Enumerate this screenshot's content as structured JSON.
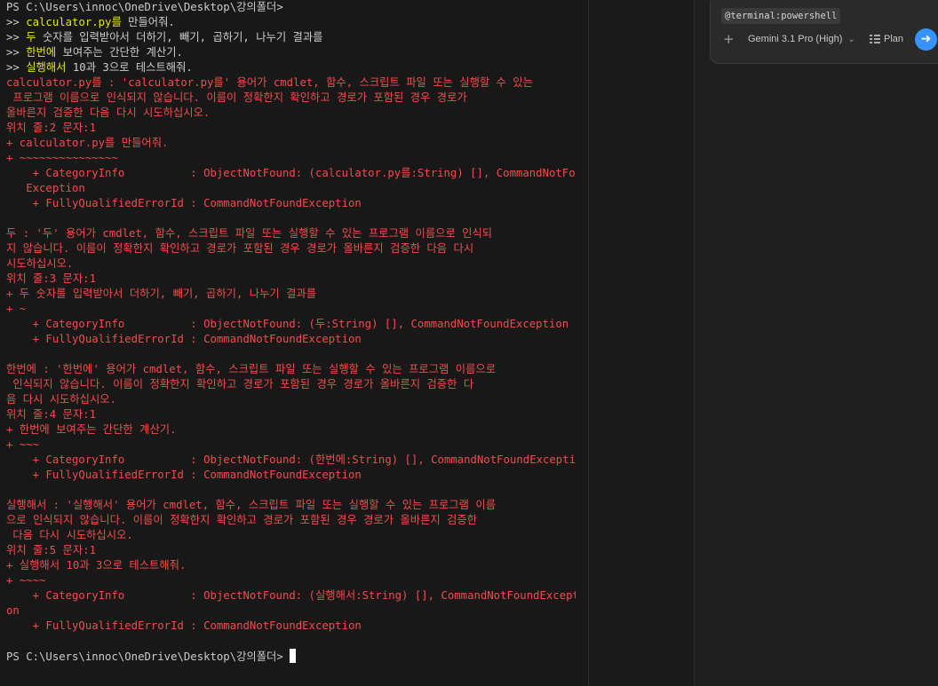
{
  "terminal": {
    "lines": [
      {
        "parts": [
          {
            "t": "PS C:\\Users\\innoc\\OneDrive\\Desktop\\강의폴더> ",
            "c": "prompt"
          }
        ]
      },
      {
        "parts": [
          {
            "t": ">> ",
            "c": "prompt"
          },
          {
            "t": "calculator.py를",
            "c": "cmd"
          },
          {
            "t": " 만들어줘.",
            "c": "arg"
          }
        ]
      },
      {
        "parts": [
          {
            "t": ">> ",
            "c": "prompt"
          },
          {
            "t": "두",
            "c": "cmd"
          },
          {
            "t": " 숫자를 입력받아서 더하기, 빼기, 곱하기, 나누기 결과를",
            "c": "arg"
          }
        ]
      },
      {
        "parts": [
          {
            "t": ">> ",
            "c": "prompt"
          },
          {
            "t": "한번에",
            "c": "cmd"
          },
          {
            "t": " 보여주는 간단한 계산기.",
            "c": "arg"
          }
        ]
      },
      {
        "parts": [
          {
            "t": ">> ",
            "c": "prompt"
          },
          {
            "t": "실행해서",
            "c": "cmd"
          },
          {
            "t": " 10과 3으로 테스트해줘.",
            "c": "arg"
          }
        ]
      },
      {
        "parts": [
          {
            "t": "calculator.py를 : 'calculator.py를' 용어가 cmdlet, 함수, 스크립트 파일 또는 실행할 수 있는",
            "c": "err"
          }
        ]
      },
      {
        "parts": [
          {
            "t": " 프로그램 이름으로 인식되지 않습니다. 이름이 정확한지 확인하고 경로가 포함된 경우 경로가",
            "c": "err"
          }
        ]
      },
      {
        "parts": [
          {
            "t": "올바른지 검증한 다음 다시 시도하십시오.",
            "c": "err"
          }
        ]
      },
      {
        "parts": [
          {
            "t": "위치 줄:2 문자:1",
            "c": "err"
          }
        ]
      },
      {
        "parts": [
          {
            "t": "+ calculator.py를 만들어줘.",
            "c": "err"
          }
        ]
      },
      {
        "parts": [
          {
            "t": "+ ~~~~~~~~~~~~~~~",
            "c": "err"
          }
        ]
      },
      {
        "parts": [
          {
            "t": "    + CategoryInfo          : ObjectNotFound: (calculator.py를:String) [], CommandNotFound",
            "c": "err"
          }
        ]
      },
      {
        "parts": [
          {
            "t": "   Exception",
            "c": "err"
          }
        ]
      },
      {
        "parts": [
          {
            "t": "    + FullyQualifiedErrorId : CommandNotFoundException",
            "c": "err"
          }
        ]
      },
      {
        "parts": [
          {
            "t": " ",
            "c": "err"
          }
        ]
      },
      {
        "parts": [
          {
            "t": "두 : '두' 용어가 cmdlet, 함수, 스크립트 파일 또는 실행할 수 있는 프로그램 이름으로 인식되",
            "c": "err"
          }
        ]
      },
      {
        "parts": [
          {
            "t": "지 않습니다. 이름이 정확한지 확인하고 경로가 포함된 경우 경로가 올바른지 검증한 다음 다시",
            "c": "err"
          }
        ]
      },
      {
        "parts": [
          {
            "t": "시도하십시오.",
            "c": "err"
          }
        ]
      },
      {
        "parts": [
          {
            "t": "위치 줄:3 문자:1",
            "c": "err"
          }
        ]
      },
      {
        "parts": [
          {
            "t": "+ 두 숫자를 입력받아서 더하기, 빼기, 곱하기, 나누기 결과를",
            "c": "err"
          }
        ]
      },
      {
        "parts": [
          {
            "t": "+ ~",
            "c": "err"
          }
        ]
      },
      {
        "parts": [
          {
            "t": "    + CategoryInfo          : ObjectNotFound: (두:String) [], CommandNotFoundException",
            "c": "err"
          }
        ]
      },
      {
        "parts": [
          {
            "t": "    + FullyQualifiedErrorId : CommandNotFoundException",
            "c": "err"
          }
        ]
      },
      {
        "parts": [
          {
            "t": " ",
            "c": "err"
          }
        ]
      },
      {
        "parts": [
          {
            "t": "한번에 : '한번에' 용어가 cmdlet, 함수, 스크립트 파일 또는 실행할 수 있는 프로그램 이름으로",
            "c": "err"
          }
        ]
      },
      {
        "parts": [
          {
            "t": " 인식되지 않습니다. 이름이 정확한지 확인하고 경로가 포함된 경우 경로가 올바른지 검증한 다",
            "c": "err"
          }
        ]
      },
      {
        "parts": [
          {
            "t": "음 다시 시도하십시오.",
            "c": "err"
          }
        ]
      },
      {
        "parts": [
          {
            "t": "위치 줄:4 문자:1",
            "c": "err"
          }
        ]
      },
      {
        "parts": [
          {
            "t": "+ 한번에 보여주는 간단한 계산기.",
            "c": "err"
          }
        ]
      },
      {
        "parts": [
          {
            "t": "+ ~~~",
            "c": "err"
          }
        ]
      },
      {
        "parts": [
          {
            "t": "    + CategoryInfo          : ObjectNotFound: (한번에:String) [], CommandNotFoundException",
            "c": "err"
          }
        ]
      },
      {
        "parts": [
          {
            "t": "    + FullyQualifiedErrorId : CommandNotFoundException",
            "c": "err"
          }
        ]
      },
      {
        "parts": [
          {
            "t": " ",
            "c": "err"
          }
        ]
      },
      {
        "parts": [
          {
            "t": "실행해서 : '실행해서' 용어가 cmdlet, 함수, 스크립트 파일 또는 실행할 수 있는 프로그램 이름",
            "c": "err"
          }
        ]
      },
      {
        "parts": [
          {
            "t": "으로 인식되지 않습니다. 이름이 정확한지 확인하고 경로가 포함된 경우 경로가 올바른지 검증한",
            "c": "err"
          }
        ]
      },
      {
        "parts": [
          {
            "t": " 다음 다시 시도하십시오.",
            "c": "err"
          }
        ]
      },
      {
        "parts": [
          {
            "t": "위치 줄:5 문자:1",
            "c": "err"
          }
        ]
      },
      {
        "parts": [
          {
            "t": "+ 실행해서 10과 3으로 테스트해줘.",
            "c": "err"
          }
        ]
      },
      {
        "parts": [
          {
            "t": "+ ~~~~",
            "c": "err"
          }
        ]
      },
      {
        "parts": [
          {
            "t": "    + CategoryInfo          : ObjectNotFound: (실행해서:String) [], CommandNotFoundExcepti",
            "c": "err"
          }
        ]
      },
      {
        "parts": [
          {
            "t": "on",
            "c": "err"
          }
        ]
      },
      {
        "parts": [
          {
            "t": "    + FullyQualifiedErrorId : CommandNotFoundException",
            "c": "err"
          }
        ]
      },
      {
        "parts": [
          {
            "t": " ",
            "c": "err"
          }
        ]
      }
    ],
    "final_prompt": "PS C:\\Users\\innoc\\OneDrive\\Desktop\\강의폴더> "
  },
  "chat": {
    "context_chip": "@terminal:powershell",
    "model_label": "Gemini 3.1 Pro (High)",
    "plan_label": "Plan",
    "icons": {
      "add": "plus-icon",
      "model_dropdown": "chevron-down-icon",
      "plan": "list-icon",
      "send": "arrow-right-icon"
    },
    "colors": {
      "send_button": "#3794ff",
      "terminal_error": "#f14c4c",
      "terminal_command": "#e5e510",
      "terminal_text": "#cccccc",
      "background": "#181818"
    }
  }
}
